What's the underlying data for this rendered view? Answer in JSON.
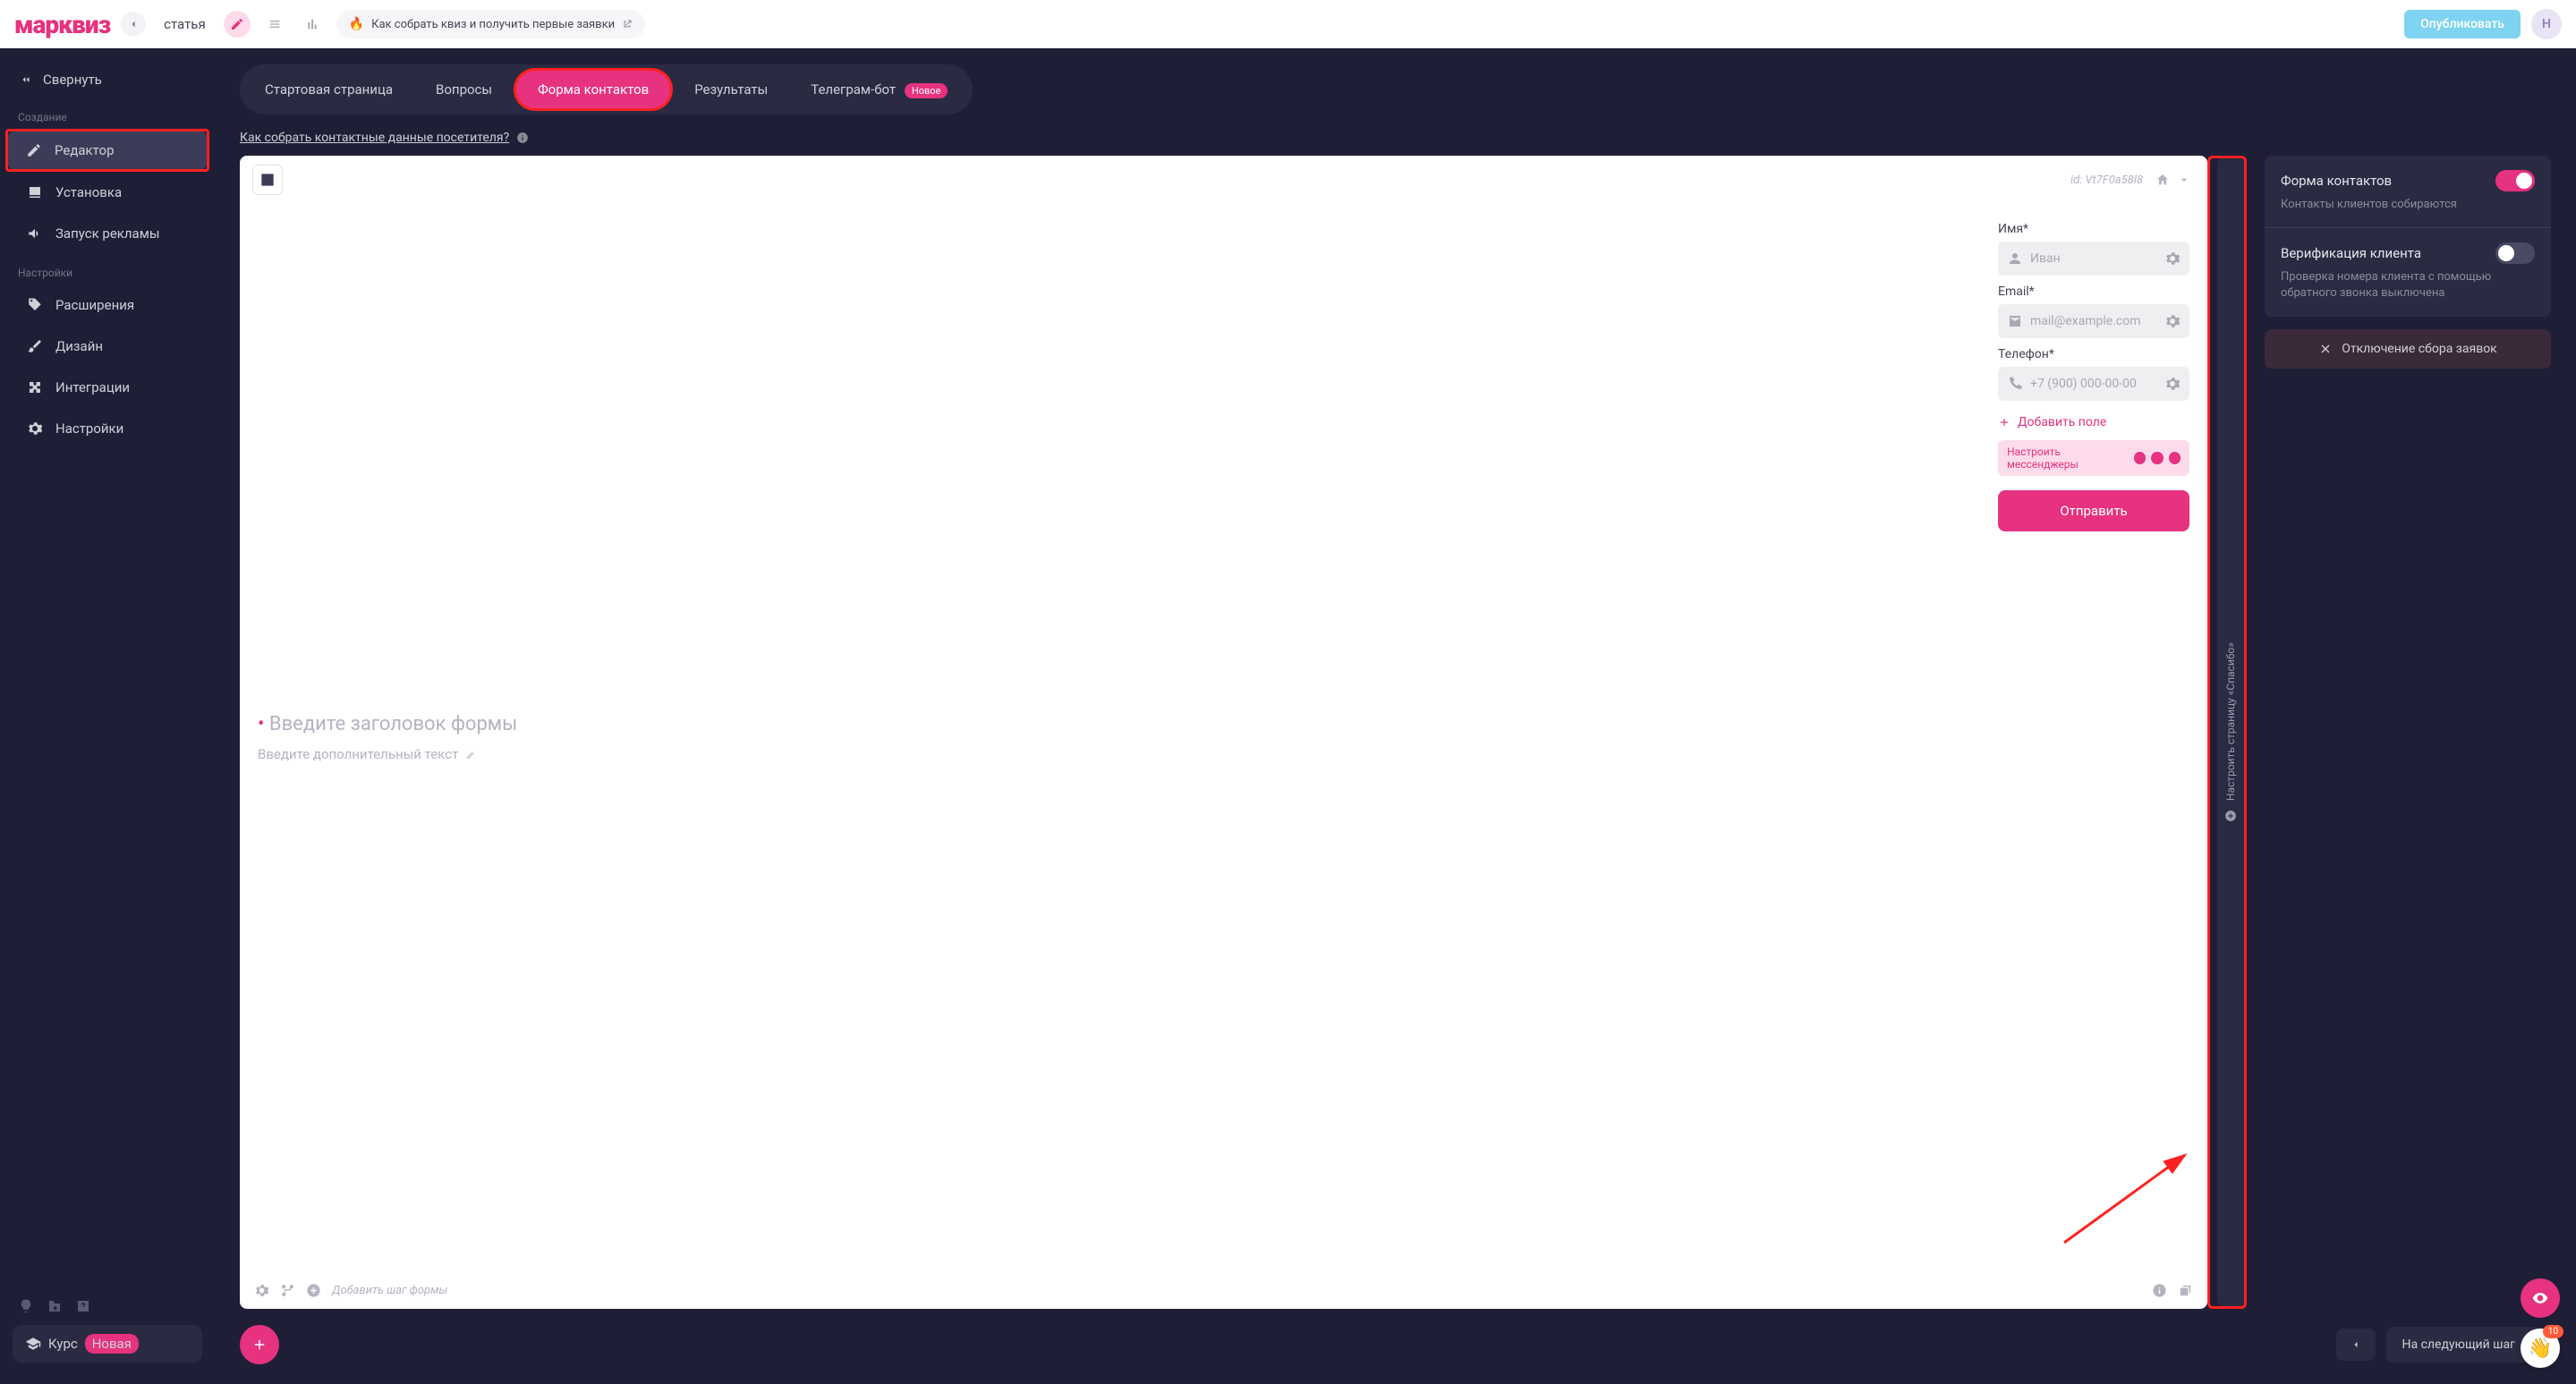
{
  "topbar": {
    "logo": "марквиз",
    "doc_name": "статья",
    "help_text": "Как собрать квиз и получить первые заявки",
    "publish": "Опубликовать",
    "avatar_letter": "Н"
  },
  "sidebar": {
    "collapse": "Свернуть",
    "section_create": "Создание",
    "section_settings": "Настройки",
    "items_create": [
      {
        "key": "editor",
        "label": "Редактор",
        "active": true
      },
      {
        "key": "install",
        "label": "Установка",
        "active": false
      },
      {
        "key": "ads",
        "label": "Запуск рекламы",
        "active": false
      }
    ],
    "items_settings": [
      {
        "key": "extensions",
        "label": "Расширения"
      },
      {
        "key": "design",
        "label": "Дизайн"
      },
      {
        "key": "integrations",
        "label": "Интеграции"
      },
      {
        "key": "settings",
        "label": "Настройки"
      }
    ],
    "course": "Курс",
    "course_badge": "Новая"
  },
  "tabs": [
    {
      "key": "start",
      "label": "Стартовая страница"
    },
    {
      "key": "questions",
      "label": "Вопросы"
    },
    {
      "key": "contacts",
      "label": "Форма контактов",
      "active": true
    },
    {
      "key": "results",
      "label": "Результаты"
    },
    {
      "key": "tgbot",
      "label": "Телеграм-бот",
      "badge": "Новое"
    }
  ],
  "hint": "Как собрать контактные данные посетителя?",
  "canvas": {
    "id": "id: Vt7F0a58l8",
    "form_title_ph": "Введите заголовок формы",
    "form_subtitle_ph": "Введите дополнительный текст",
    "fields": [
      {
        "label": "Имя*",
        "ph": "Иван",
        "icon": "user"
      },
      {
        "label": "Email*",
        "ph": "mail@example.com",
        "icon": "mail"
      },
      {
        "label": "Телефон*",
        "ph": "+7 (900) 000-00-00",
        "icon": "phone"
      }
    ],
    "add_field": "Добавить поле",
    "messengers": "Настроить мессенджеры",
    "submit": "Отправить",
    "add_step_ph": "Добавить шаг формы",
    "thanks_label": "Настроить страницу «Спасибо»"
  },
  "right_panel": {
    "rows": [
      {
        "title": "Форма контактов",
        "desc": "Контакты клиентов собираются",
        "on": true
      },
      {
        "title": "Верификация клиента",
        "desc": "Проверка номера клиента с помощью обратного звонка выключена",
        "on": false
      }
    ],
    "disable": "Отключение сбора заявок"
  },
  "bottom": {
    "next": "На следующий шаг"
  },
  "notifications": "10"
}
